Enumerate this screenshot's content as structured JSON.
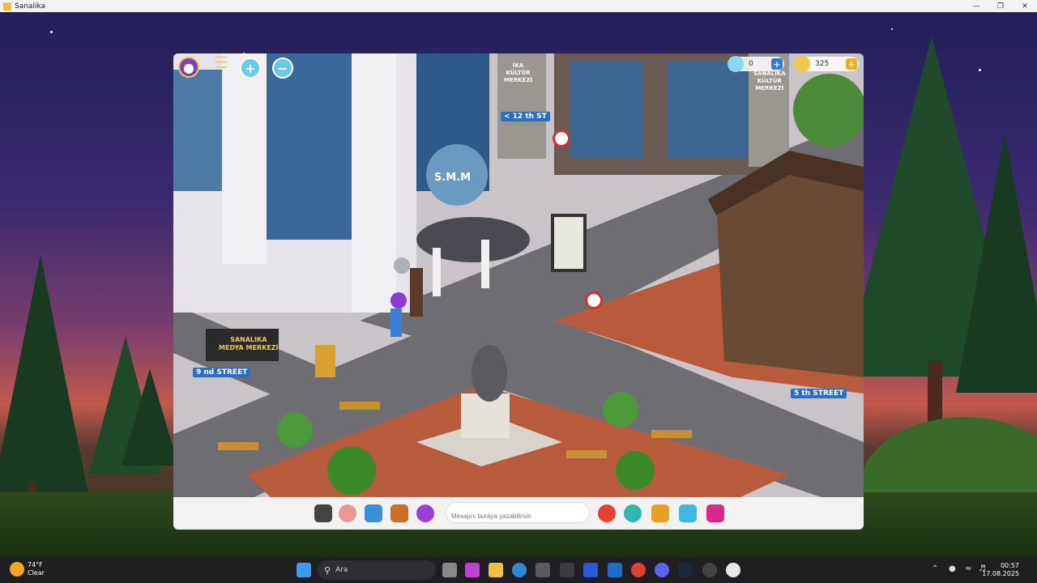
{
  "window": {
    "title": "Sanalika"
  },
  "hud": {
    "diamonds": "0",
    "gold": "325"
  },
  "signs": {
    "street_12": "< 12 th ST",
    "street_9": "9 nd STREET",
    "street_5": "5 th STREET",
    "smm": "S.M.M",
    "media_center_1": "SANALIKA",
    "media_center_2": "MEDYA MERKEZİ",
    "culture_left_1": "İKA",
    "culture_left_2": "KÜLTÜR",
    "culture_left_3": "MERKEZİ",
    "culture_right_1": "SANALIKA",
    "culture_right_2": "KÜLTÜR",
    "culture_right_3": "MERKEZİ"
  },
  "chat": {
    "placeholder": "Mesajını buraya yazabilirsin"
  },
  "taskbar": {
    "temperature": "74°F",
    "condition": "Clear",
    "search_label": "Ara",
    "time": "00:57",
    "date": "17.08.2025"
  },
  "colors": {
    "diamond_plus": "#2f7bd8",
    "gold_plus": "#e7b21f",
    "street_sign": "#2a6fc2"
  }
}
